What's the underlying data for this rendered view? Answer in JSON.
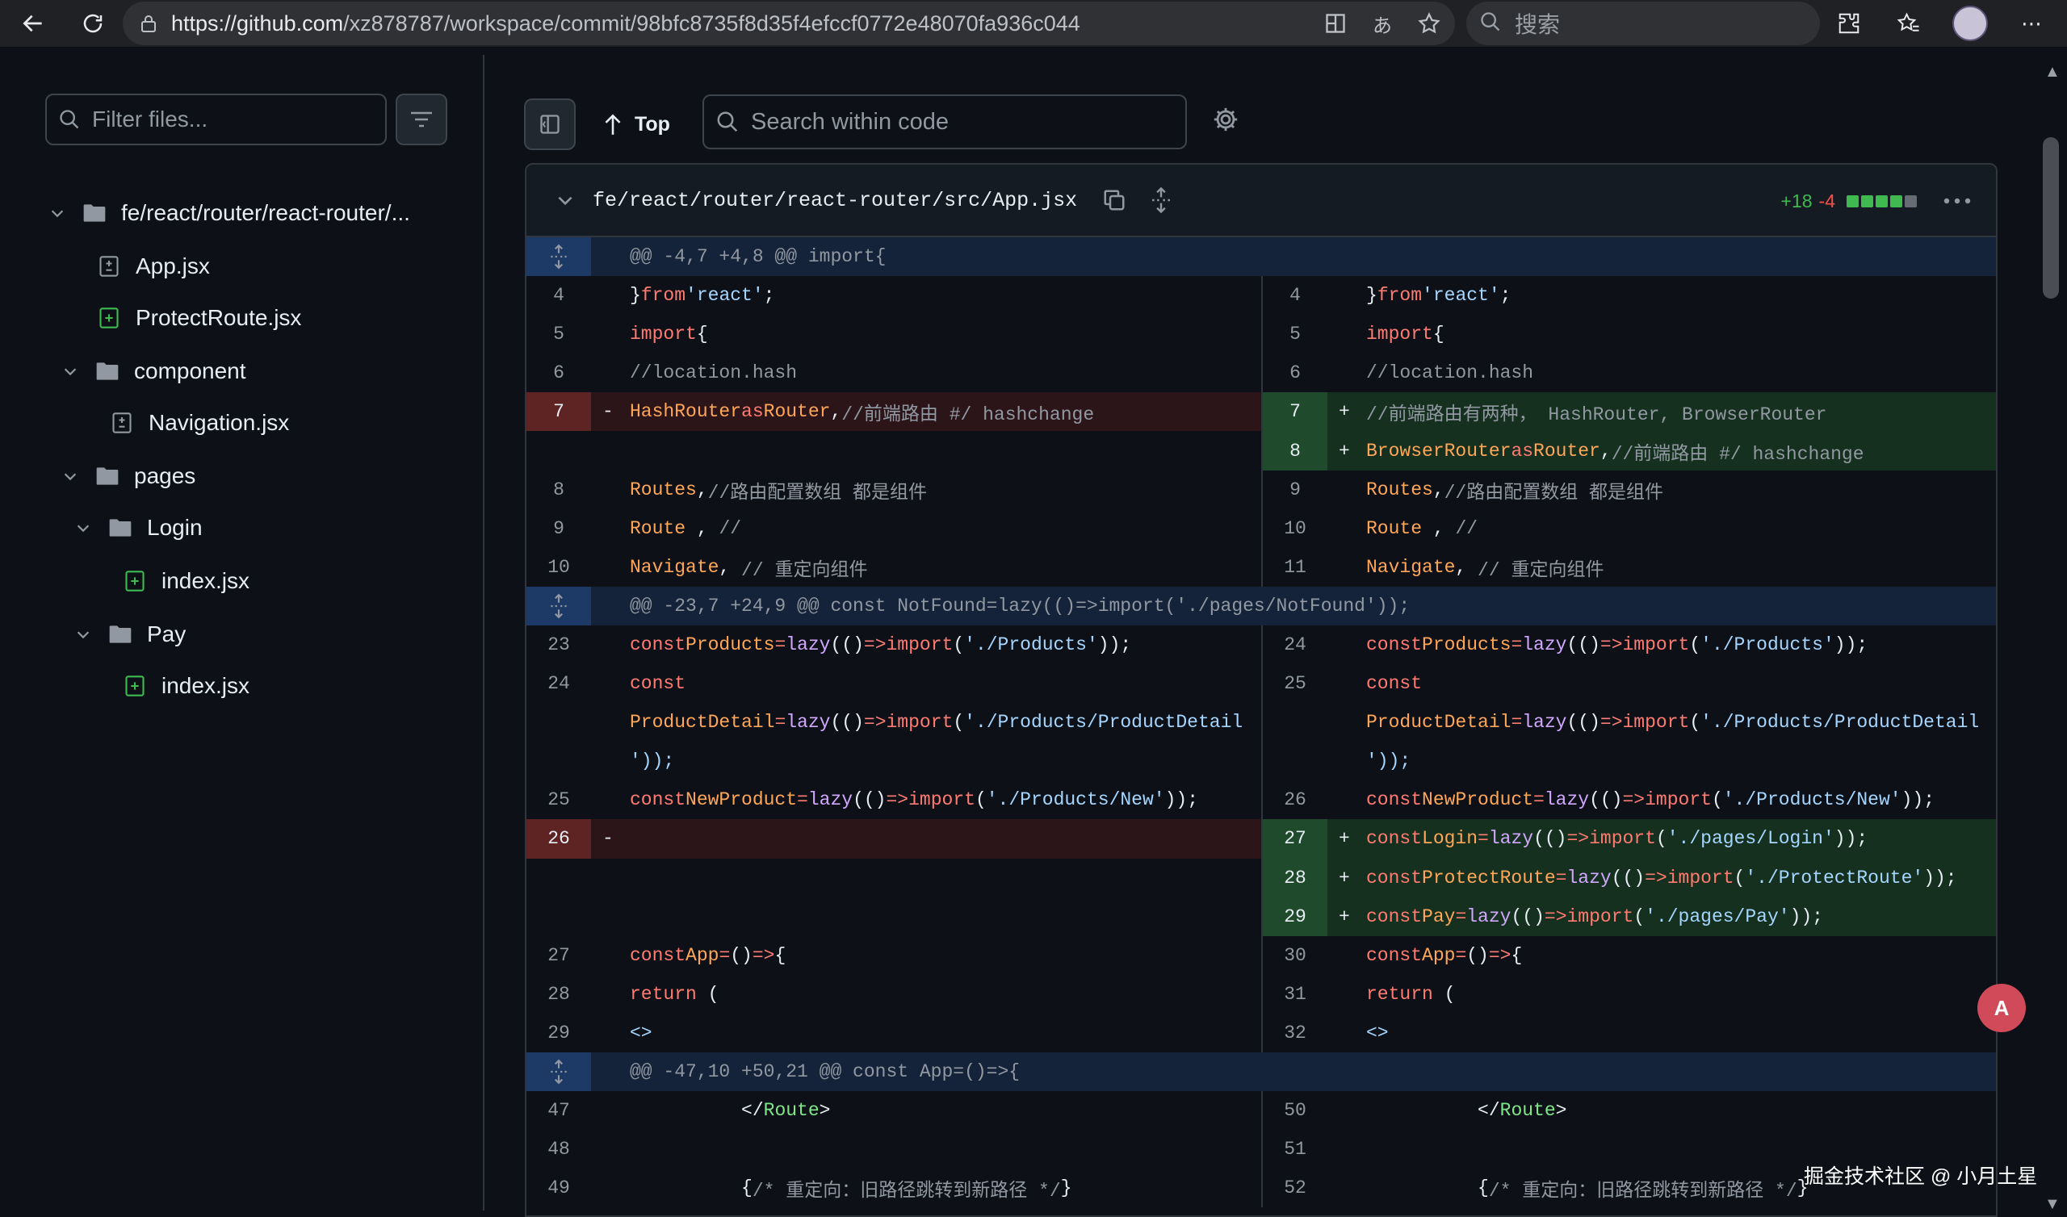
{
  "browser": {
    "url": "https://github.com/xz878787/workspace/commit/98bfc8735f8d35f4efccf0772e48070fa936c044",
    "url_host": "https://github.com",
    "url_path": "/xz878787/workspace/commit/98bfc8735f8d35f4efccf0772e48070fa936c044",
    "search_placeholder": "搜索"
  },
  "sidebar": {
    "filter_placeholder": "Filter files...",
    "tree": [
      {
        "label": "fe/react/router/react-router/...",
        "type": "folder",
        "depth": 0,
        "expanded": true
      },
      {
        "label": "App.jsx",
        "type": "file-modified",
        "depth": 1
      },
      {
        "label": "ProtectRoute.jsx",
        "type": "file-added",
        "depth": 1
      },
      {
        "label": "component",
        "type": "folder",
        "depth": 1,
        "expanded": true
      },
      {
        "label": "Navigation.jsx",
        "type": "file-modified",
        "depth": 2
      },
      {
        "label": "pages",
        "type": "folder",
        "depth": 1,
        "expanded": true
      },
      {
        "label": "Login",
        "type": "folder",
        "depth": 2,
        "expanded": true
      },
      {
        "label": "index.jsx",
        "type": "file-added",
        "depth": 3
      },
      {
        "label": "Pay",
        "type": "folder",
        "depth": 2,
        "expanded": true
      },
      {
        "label": "index.jsx",
        "type": "file-added",
        "depth": 3
      }
    ]
  },
  "toolbar": {
    "top_label": "Top",
    "search_placeholder": "Search within code"
  },
  "diff": {
    "file_path": "fe/react/router/react-router/src/App.jsx",
    "additions": "+18",
    "deletions": "-4",
    "stat_blocks": [
      "add",
      "add",
      "add",
      "add",
      "neutral"
    ],
    "colors": {
      "add": "#3fb950",
      "del": "#f85149",
      "neutral": "#656c76"
    },
    "rows": [
      {
        "kind": "hunk",
        "text": "@@ -4,7 +4,8 @@ import{"
      },
      {
        "kind": "ctx",
        "l": {
          "n": "4",
          "t": "}from 'react';"
        },
        "r": {
          "n": "4",
          "t": "}from 'react';"
        }
      },
      {
        "kind": "ctx",
        "l": {
          "n": "5",
          "t": "import{"
        },
        "r": {
          "n": "5",
          "t": "import{"
        }
      },
      {
        "kind": "ctx",
        "l": {
          "n": "6",
          "t": "  //location.hash"
        },
        "r": {
          "n": "6",
          "t": "  //location.hash"
        }
      },
      {
        "kind": "chg",
        "l": {
          "n": "7",
          "m": "-",
          "t": "  HashRouter as Router,//前端路由 #/ hashchange",
          "type": "del"
        },
        "r": {
          "n": "7",
          "m": "+",
          "t": "  //前端路由有两种， HashRouter, BrowserRouter",
          "type": "add"
        }
      },
      {
        "kind": "chg",
        "l": {
          "n": "",
          "m": "",
          "t": "",
          "type": "empty"
        },
        "r": {
          "n": "8",
          "m": "+",
          "t": "  BrowserRouter as Router,//前端路由 #/ hashchange",
          "type": "add"
        }
      },
      {
        "kind": "ctx",
        "l": {
          "n": "8",
          "t": "  Routes,//路由配置数组 都是组件"
        },
        "r": {
          "n": "9",
          "t": "  Routes,//路由配置数组 都是组件"
        }
      },
      {
        "kind": "ctx",
        "l": {
          "n": "9",
          "t": "  Route , //"
        },
        "r": {
          "n": "10",
          "t": "  Route , //"
        }
      },
      {
        "kind": "ctx",
        "l": {
          "n": "10",
          "t": "  Navigate, // 重定向组件"
        },
        "r": {
          "n": "11",
          "t": "  Navigate, // 重定向组件"
        }
      },
      {
        "kind": "hunk",
        "text": "@@ -23,7 +24,9 @@ const NotFound=lazy(()=>import('./pages/NotFound'));"
      },
      {
        "kind": "ctx",
        "l": {
          "n": "23",
          "t": "const Products=lazy(()=>import('./Products'));"
        },
        "r": {
          "n": "24",
          "t": "const Products=lazy(()=>import('./Products'));"
        }
      },
      {
        "kind": "ctx",
        "l": {
          "n": "24",
          "t": "const"
        },
        "r": {
          "n": "25",
          "t": "const"
        }
      },
      {
        "kind": "ctx",
        "l": {
          "n": "",
          "t": "ProductDetail=lazy(()=>import('./Products/ProductDetail"
        },
        "r": {
          "n": "",
          "t": "ProductDetail=lazy(()=>import('./Products/ProductDetail"
        }
      },
      {
        "kind": "ctx",
        "l": {
          "n": "",
          "t": "'));"
        },
        "r": {
          "n": "",
          "t": "'));"
        }
      },
      {
        "kind": "ctx",
        "l": {
          "n": "25",
          "t": "const NewProduct=lazy(()=>import('./Products/New'));"
        },
        "r": {
          "n": "26",
          "t": "const NewProduct=lazy(()=>import('./Products/New'));"
        }
      },
      {
        "kind": "chg",
        "l": {
          "n": "26",
          "m": "-",
          "t": "",
          "type": "del"
        },
        "r": {
          "n": "27",
          "m": "+",
          "t": "const Login=lazy(()=>import('./pages/Login'));",
          "type": "add"
        }
      },
      {
        "kind": "chg",
        "l": {
          "n": "",
          "m": "",
          "t": "",
          "type": "empty"
        },
        "r": {
          "n": "28",
          "m": "+",
          "t": "const ProtectRoute=lazy(()=>import('./ProtectRoute'));",
          "type": "add"
        }
      },
      {
        "kind": "chg",
        "l": {
          "n": "",
          "m": "",
          "t": "",
          "type": "empty"
        },
        "r": {
          "n": "29",
          "m": "+",
          "t": "const Pay=lazy(()=>import('./pages/Pay'));",
          "type": "add"
        }
      },
      {
        "kind": "ctx",
        "l": {
          "n": "27",
          "t": "const App=()=>{"
        },
        "r": {
          "n": "30",
          "t": "const App=()=>{"
        }
      },
      {
        "kind": "ctx",
        "l": {
          "n": "28",
          "t": "  return ("
        },
        "r": {
          "n": "31",
          "t": "  return ("
        }
      },
      {
        "kind": "ctx",
        "l": {
          "n": "29",
          "t": "    <>"
        },
        "r": {
          "n": "32",
          "t": "    <>"
        }
      },
      {
        "kind": "hunk",
        "text": "@@ -47,10 +50,21 @@ const App=()=>{"
      },
      {
        "kind": "ctx",
        "l": {
          "n": "47",
          "t": "          </Route>"
        },
        "r": {
          "n": "50",
          "t": "          </Route>"
        }
      },
      {
        "kind": "ctx",
        "l": {
          "n": "48",
          "t": ""
        },
        "r": {
          "n": "51",
          "t": ""
        }
      },
      {
        "kind": "ctx",
        "l": {
          "n": "49",
          "t": "          {/* 重定向：旧路径跳转到新路径 */}"
        },
        "r": {
          "n": "52",
          "t": "          {/* 重定向：旧路径跳转到新路径 */}"
        }
      }
    ]
  },
  "watermark": "掘金技术社区 @ 小月土星",
  "translate_fab": "A"
}
